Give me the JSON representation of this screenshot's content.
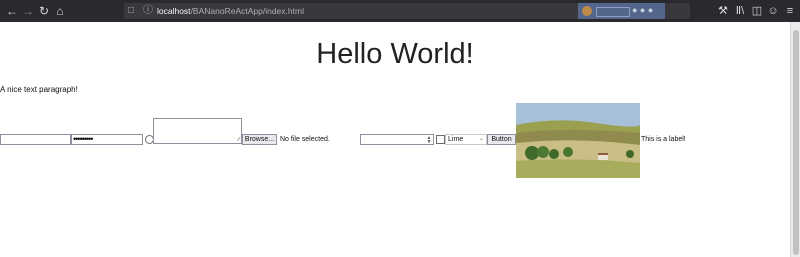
{
  "browser": {
    "url_host": "localhost",
    "url_path": "/BANanoReActApp/index.html",
    "icons": {
      "back": "back-arrow-icon",
      "forward": "forward-arrow-icon",
      "reload": "reload-icon",
      "home": "home-icon",
      "page_info": "page-icon",
      "site_info": "info-icon",
      "tools": "wrench-icon",
      "library": "library-icon",
      "sidebar": "sidebar-icon",
      "account": "account-icon",
      "menu": "hamburger-menu-icon"
    }
  },
  "page": {
    "heading": "Hello World!",
    "paragraph": "A nice text paragraph!",
    "password_mask": "•••••••••",
    "browse_label": "Browse...",
    "file_status": "No file selected.",
    "select_value": "Lime",
    "button_label": "Button",
    "label_text": "This is a label!"
  },
  "image": {
    "subject": "countryside landscape with hills, fields and trees",
    "colors": {
      "sky": "#a7c0d9",
      "hills": "#9aa04f",
      "field": "#c9bf86",
      "trees": "#3f6a2a"
    }
  }
}
